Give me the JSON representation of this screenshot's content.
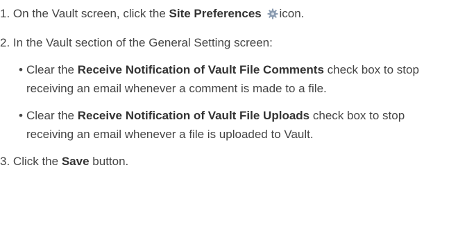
{
  "steps": [
    {
      "num": "1.",
      "pre": "On the Vault screen, click the",
      "bold": "Site Preferences",
      "icon": "gear-icon",
      "post": "icon."
    },
    {
      "num": "2.",
      "text": "In the Vault section of the General Setting screen:"
    },
    {
      "num": "3.",
      "pre": "Click the",
      "bold": "Save",
      "post": "button."
    }
  ],
  "bullets": [
    {
      "dot": "•",
      "pre": "Clear the",
      "bold": "Receive Notification of Vault File Comments",
      "post": "check box to stop receiving an email whenever a comment is made to a file."
    },
    {
      "dot": "•",
      "pre": "Clear the",
      "bold": "Receive Notification of Vault File Uploads",
      "post": "check box to stop receiving an email whenever a file is uploaded to Vault."
    }
  ],
  "colors": {
    "text": "#444444",
    "icon": "#8a9bb0"
  }
}
